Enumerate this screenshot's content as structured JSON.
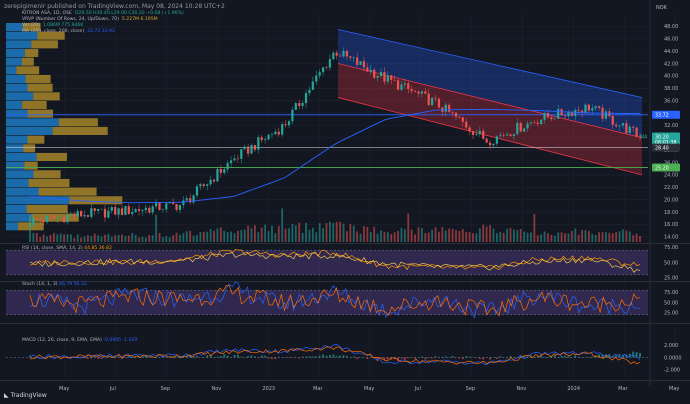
{
  "header": {
    "publisher_line": "zerepigimenir published on TradingView.com, May 08, 2024 10:28 UTC+2",
    "currency": "NOK",
    "logo_text": "TradingView"
  },
  "legends": {
    "symbol": {
      "label": "KITRON ASA, 1D, OSE",
      "values": "O29.50 H30.40 L29.00 C30.20 +0.08 (+1.96%)"
    },
    "vrvp": {
      "label": "VRVP (Number Of Rows, 24, Up/Down, 70)",
      "values": "5.227M  6.195M"
    },
    "vol": {
      "label": "Vol (20)",
      "values": "1.086M  775.946K"
    },
    "ma": {
      "label": "MA (200, close, 200, close)",
      "values": "33.72  33.92"
    },
    "rsi": {
      "label": "RSI (14, close, SMA, 14, 2)",
      "values": "44.85  36.82"
    },
    "stoch": {
      "label": "Stoch (14, 1, 3)",
      "values": "46.79  56.32"
    },
    "macd": {
      "label": "MACD (12, 26, close, 9, EMA, EMA)",
      "values": "-0.0905  -1.029"
    }
  },
  "price_badges": {
    "upper_level": "33.72",
    "last": "30.20",
    "countdown": "08:01:38",
    "label_g": "MA",
    "mid_level": "28.40",
    "lower_level": "25.20"
  },
  "colors": {
    "background": "#131722",
    "grid": "#1e222d",
    "up": "#26a69a",
    "down": "#ef5350",
    "channel_upper": "#2962ff",
    "channel_lower": "#f23645",
    "hline_blue": "#2962ff",
    "hline_green": "#4caf50",
    "ma_line": "#2962ff",
    "vrvp_up": "#2196f3",
    "vrvp_down": "#d4a72c",
    "rsi_line": "#ff9800",
    "stoch_k": "#2962ff",
    "stoch_d": "#ff6d00",
    "oscillator_band": "#7e57c2"
  },
  "chart_data": [
    {
      "type": "line",
      "title": "KITRON ASA, 1D, OSE",
      "xlabel": "",
      "ylabel": "",
      "x": [
        "May",
        "Jul",
        "Sep",
        "Nov",
        "2023",
        "Mar",
        "May",
        "Jul",
        "Sep",
        "Nov",
        "2024",
        "Mar",
        "May"
      ],
      "series": [
        {
          "name": "KITRON ASA, 1D, OSE",
          "values": [
            16.5,
            17.6,
            18.3,
            19.2,
            26.5,
            32.0,
            44.0,
            39.5,
            35.5,
            29.5,
            33.0,
            35.0,
            30.2
          ]
        },
        {
          "name": "MA (200, close, 200, close)",
          "values": [
            20.5,
            19.8,
            19.5,
            19.6,
            20.5,
            23.5,
            29.0,
            33.0,
            34.5,
            34.6,
            34.4,
            34.0,
            33.9
          ]
        }
      ],
      "ylim": [
        13.0,
        50.0
      ],
      "y_ticks": [
        "14.00",
        "16.00",
        "18.00",
        "20.00",
        "22.00",
        "24.00",
        "26.00",
        "28.00",
        "30.00",
        "32.00",
        "34.00",
        "36.00",
        "38.00",
        "40.00",
        "42.00",
        "44.00",
        "46.00",
        "48.00"
      ],
      "levels": [
        33.72,
        28.4,
        25.2
      ],
      "grid": true
    },
    {
      "type": "bar",
      "title": "Vol (20)",
      "categories": [
        "May",
        "Jul",
        "Sep",
        "Nov",
        "2023",
        "Mar",
        "May",
        "Jul",
        "Sep",
        "Nov",
        "2024",
        "Mar",
        "May"
      ],
      "values": [
        0.9,
        0.7,
        0.8,
        0.9,
        1.4,
        1.6,
        1.8,
        1.2,
        1.3,
        1.5,
        1.1,
        1.2,
        1.086
      ]
    },
    {
      "type": "line",
      "title": "RSI (14, close, SMA, 14, 2)",
      "x": [
        "May",
        "Jul",
        "Sep",
        "Nov",
        "2023",
        "Mar",
        "May",
        "Jul",
        "Sep",
        "Nov",
        "2024",
        "Mar",
        "May"
      ],
      "series": [
        {
          "name": "RSI",
          "values": [
            48,
            52,
            50,
            55,
            68,
            62,
            66,
            44,
            42,
            40,
            55,
            58,
            44.85
          ]
        },
        {
          "name": "RSI-based MA",
          "values": [
            47,
            50,
            51,
            53,
            63,
            60,
            61,
            48,
            43,
            42,
            51,
            55,
            36.82
          ]
        }
      ],
      "ylim": [
        20,
        80
      ],
      "y_ticks": [
        "25.00",
        "50.00",
        "75.00"
      ],
      "levels": [
        70,
        30
      ]
    },
    {
      "type": "line",
      "title": "Stoch (14, 1, 3)",
      "x": [
        "May",
        "Jul",
        "Sep",
        "Nov",
        "2023",
        "Mar",
        "May",
        "Jul",
        "Sep",
        "Nov",
        "2024",
        "Mar",
        "May"
      ],
      "series": [
        {
          "name": "%K",
          "values": [
            60,
            40,
            70,
            55,
            80,
            45,
            75,
            30,
            60,
            25,
            70,
            40,
            46.79
          ]
        },
        {
          "name": "%D",
          "values": [
            55,
            45,
            65,
            58,
            72,
            50,
            68,
            35,
            55,
            30,
            62,
            45,
            56.32
          ]
        }
      ],
      "ylim": [
        0,
        100
      ],
      "y_ticks": [
        "25.00",
        "50.00",
        "75.00"
      ],
      "levels": [
        80,
        20
      ]
    },
    {
      "type": "line",
      "title": "MACD (12, 26, close, 9, EMA, EMA)",
      "x": [
        "May",
        "Jul",
        "Sep",
        "Nov",
        "2023",
        "Mar",
        "May",
        "Jul",
        "Sep",
        "Nov",
        "2024",
        "Mar",
        "May"
      ],
      "series": [
        {
          "name": "MACD",
          "values": [
            0.2,
            0.1,
            0.3,
            0.4,
            1.2,
            1.0,
            2.0,
            -0.8,
            -0.6,
            -1.0,
            0.6,
            0.7,
            -0.09
          ]
        },
        {
          "name": "Signal",
          "values": [
            0.1,
            0.15,
            0.2,
            0.3,
            0.9,
            1.1,
            1.6,
            -0.3,
            -0.7,
            -0.9,
            0.3,
            0.6,
            -1.03
          ]
        }
      ],
      "ylim": [
        -3.5,
        3.5
      ],
      "y_ticks": [
        "2.000",
        "0.0000",
        "-2.000"
      ],
      "levels": [
        0
      ]
    }
  ]
}
